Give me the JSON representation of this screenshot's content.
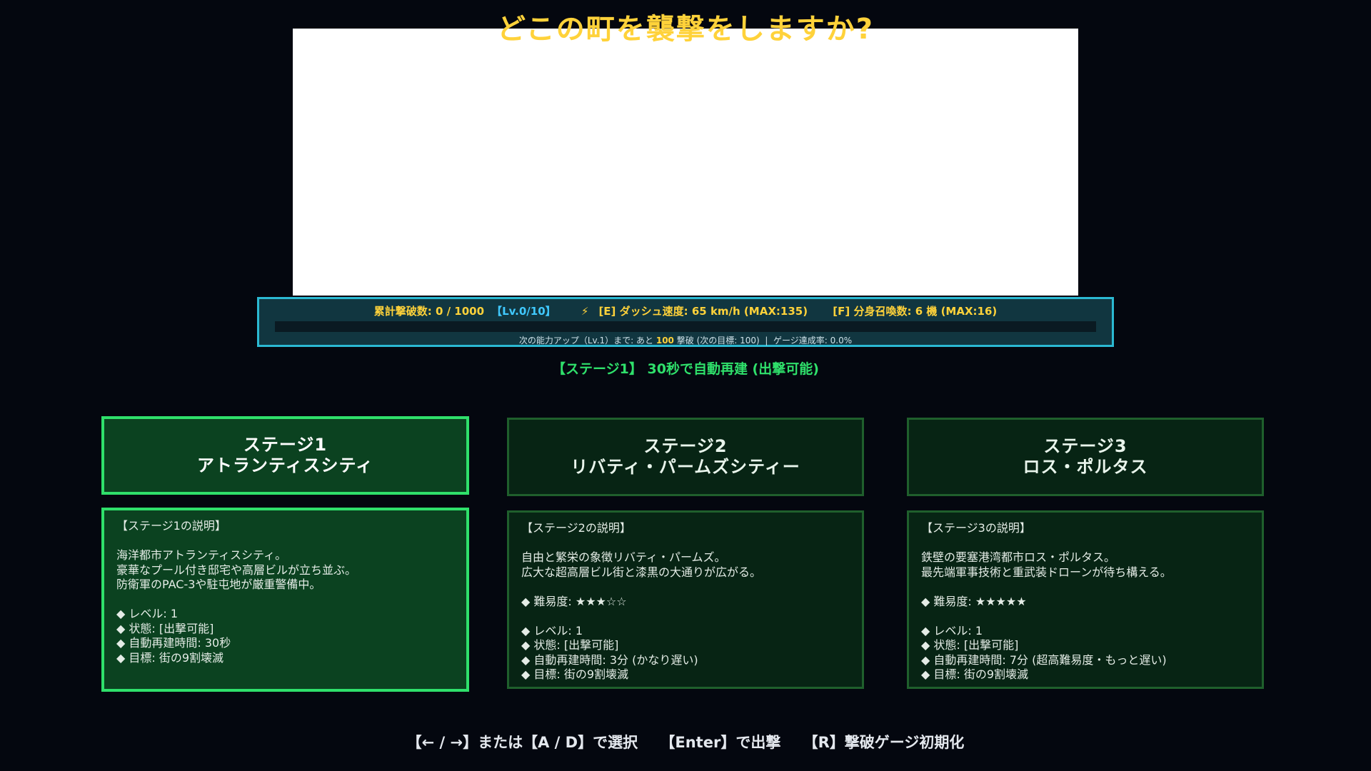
{
  "title": "どこの町を襲撃をしますか?",
  "hud": {
    "total_kills": "累計撃破数: 0 / 1000",
    "level": "【Lv.0/10】",
    "bolt_icon": "⚡",
    "dash": "[E] ダッシュ速度: 65 km/h (MAX:135)",
    "clones": "[F] 分身召喚数: 6 機 (MAX:16)",
    "gauge_progress": 0.0,
    "next_prefix": "次の能力アップ（Lv.1）まで: あと",
    "next_remaining": "100",
    "next_suffix": "撃破 (次の目標: 100)",
    "separator": "|",
    "gauge_rate": "ゲージ達成率: 0.0%"
  },
  "status_line": "【ステージ1】 30秒で自動再建 (出撃可能)",
  "stages": [
    {
      "name_line1": "ステージ1",
      "name_line2": "アトランティスシティ",
      "description": "【ステージ1の説明】\n\n海洋都市アトランティスシティ。\n豪華なプール付き邸宅や高層ビルが立ち並ぶ。\n防衛軍のPAC-3や駐屯地が厳重警備中。\n\n◆ レベル: 1\n◆ 状態: [出撃可能]\n◆ 自動再建時間: 30秒\n◆ 目標: 街の9割壊滅"
    },
    {
      "name_line1": "ステージ2",
      "name_line2": "リバティ・パームズシティー",
      "description": "【ステージ2の説明】\n\n自由と繁栄の象徴リバティ・パームズ。\n広大な超高層ビル街と漆黒の大通りが広がる。\n\n◆ 難易度: ★★★☆☆\n\n◆ レベル: 1\n◆ 状態: [出撃可能]\n◆ 自動再建時間: 3分 (かなり遅い)\n◆ 目標: 街の9割壊滅"
    },
    {
      "name_line1": "ステージ3",
      "name_line2": "ロス・ポルタス",
      "description": "【ステージ3の説明】\n\n鉄壁の要塞港湾都市ロス・ポルタス。\n最先端軍事技術と重武装ドローンが待ち構える。\n\n◆ 難易度: ★★★★★\n\n◆ レベル: 1\n◆ 状態: [出撃可能]\n◆ 自動再建時間: 7分 (超高難易度・もっと遅い)\n◆ 目標: 街の9割壊滅"
    }
  ],
  "footer": {
    "select": "【← / →】または【A / D】で選択",
    "launch": "【Enter】で出撃",
    "reset": "【R】撃破ゲージ初期化"
  },
  "colors": {
    "background": "#04070f",
    "title": "#ffd23a",
    "accent_green": "#2fe06b",
    "hud_border": "#2bb9d2",
    "level_blue": "#40c9ff"
  }
}
